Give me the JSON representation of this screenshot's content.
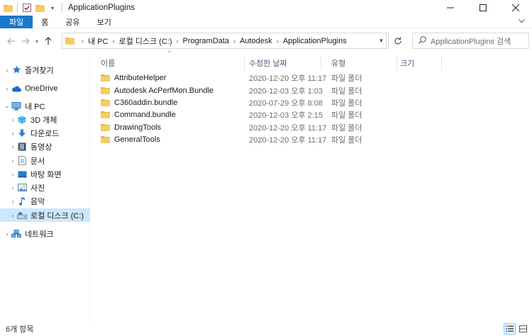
{
  "window": {
    "title": "ApplicationPlugins",
    "controls": [
      "minimize-icon",
      "maximize-icon",
      "close-icon"
    ]
  },
  "ribbon": {
    "file_tab": "파일",
    "tabs": [
      "홈",
      "공유",
      "보기"
    ]
  },
  "address": {
    "crumbs": [
      "내 PC",
      "로컬 디스크 (C:)",
      "ProgramData",
      "Autodesk",
      "ApplicationPlugins"
    ]
  },
  "search": {
    "placeholder": "ApplicationPlugins 검색"
  },
  "navpane": {
    "items": [
      {
        "label": "즐겨찾기",
        "icon": "star-icon"
      },
      {
        "label": "OneDrive",
        "icon": "cloud-icon"
      },
      {
        "label": "내 PC",
        "icon": "computer-icon"
      },
      {
        "label": "3D 개체",
        "icon": "cube-icon"
      },
      {
        "label": "다운로드",
        "icon": "download-icon"
      },
      {
        "label": "동영상",
        "icon": "video-icon"
      },
      {
        "label": "문서",
        "icon": "document-icon"
      },
      {
        "label": "바탕 화면",
        "icon": "desktop-icon"
      },
      {
        "label": "사진",
        "icon": "picture-icon"
      },
      {
        "label": "음악",
        "icon": "music-icon"
      },
      {
        "label": "로컬 디스크 (C:)",
        "icon": "drive-icon"
      },
      {
        "label": "네트워크",
        "icon": "network-icon"
      }
    ],
    "selected": "로컬 디스크 (C:)"
  },
  "columns": {
    "name": "이름",
    "date": "수정한 날짜",
    "type": "유형",
    "size": "크기"
  },
  "files": [
    {
      "name": "AttributeHelper",
      "date": "2020-12-20 오후 11:17",
      "type": "파일 폴더"
    },
    {
      "name": "Autodesk AcPerfMon.Bundle",
      "date": "2020-12-03 오후 1:03",
      "type": "파일 폴더"
    },
    {
      "name": "C360addin.bundle",
      "date": "2020-07-29 오후 8:08",
      "type": "파일 폴더"
    },
    {
      "name": "Command.bundle",
      "date": "2020-12-03 오후 2:15",
      "type": "파일 폴더"
    },
    {
      "name": "DrawingTools",
      "date": "2020-12-20 오후 11:17",
      "type": "파일 폴더"
    },
    {
      "name": "GeneralTools",
      "date": "2020-12-20 오후 11:17",
      "type": "파일 폴더"
    }
  ],
  "status": {
    "count": "6개 항목"
  },
  "colors": {
    "accent": "#1979ca",
    "folder": "#f2c55c",
    "selected_bg": "#cce8ff"
  }
}
